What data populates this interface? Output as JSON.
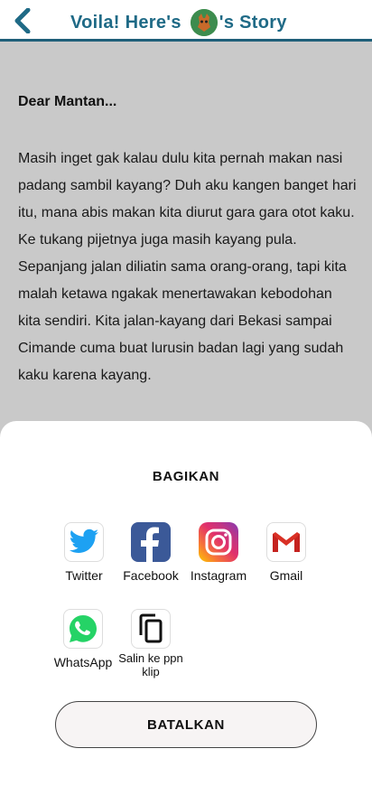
{
  "header": {
    "title_prefix": "Voila! Here's",
    "title_suffix": "'s Story",
    "back_icon": "chevron-left-icon",
    "accent_color": "#1f6a86"
  },
  "story": {
    "greeting": "Dear Mantan...",
    "body": "Masih inget gak kalau dulu kita pernah makan nasi padang sambil kayang? Duh aku kangen banget hari itu, mana abis makan kita diurut gara gara otot kaku. Ke tukang pijetnya juga masih kayang pula. Sepanjang jalan diliatin sama orang-orang, tapi kita malah ketawa ngakak menertawakan kebodohan kita sendiri. Kita jalan-kayang dari Bekasi sampai Cimande cuma buat lurusin badan lagi yang sudah kaku karena kayang."
  },
  "share_sheet": {
    "title": "BAGIKAN",
    "items": [
      {
        "label": "Twitter",
        "icon": "twitter-icon"
      },
      {
        "label": "Facebook",
        "icon": "facebook-icon"
      },
      {
        "label": "Instagram",
        "icon": "instagram-icon"
      },
      {
        "label": "Gmail",
        "icon": "gmail-icon"
      },
      {
        "label": "WhatsApp",
        "icon": "whatsapp-icon"
      },
      {
        "label": "Salin ke ppn klip",
        "icon": "copy-icon"
      }
    ],
    "cancel_label": "BATALKAN"
  }
}
